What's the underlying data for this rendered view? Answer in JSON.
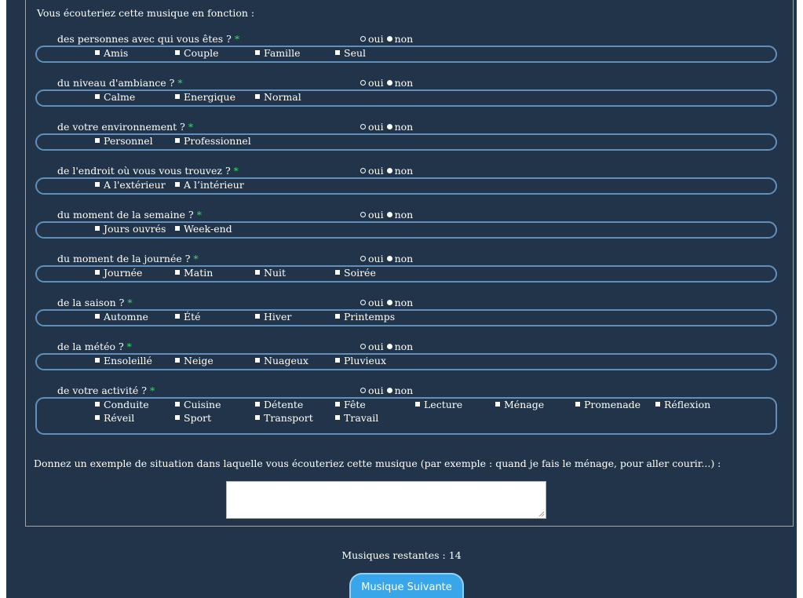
{
  "intro": "Vous écouteriez cette musique en fonction :",
  "yes_label": "oui",
  "no_label": "non",
  "required_mark": "*",
  "questions": [
    {
      "label": "des personnes avec qui vous êtes ?",
      "options": [
        "Amis",
        "Couple",
        "Famille",
        "Seul"
      ]
    },
    {
      "label": "du niveau d'ambiance ?",
      "options": [
        "Calme",
        "Energique",
        "Normal"
      ]
    },
    {
      "label": "de votre environnement ?",
      "options": [
        "Personnel",
        "Professionnel"
      ]
    },
    {
      "label": "de l'endroit où vous vous trouvez ?",
      "options": [
        "A l'extérieur",
        "A l’intérieur"
      ]
    },
    {
      "label": "du moment de la semaine ?",
      "options": [
        "Jours ouvrés",
        "Week-end"
      ]
    },
    {
      "label": "du moment de la journée ?",
      "options": [
        "Journée",
        "Matin",
        "Nuit",
        "Soirée"
      ]
    },
    {
      "label": "de la saison ?",
      "options": [
        "Automne",
        "Été",
        "Hiver",
        "Printemps"
      ]
    },
    {
      "label": "de la météo ?",
      "options": [
        "Ensoleillé",
        "Neige",
        "Nuageux",
        "Pluvieux"
      ]
    },
    {
      "label": "de votre activité ?",
      "options": [
        "Conduite",
        "Cuisine",
        "Détente",
        "Fête",
        "Lecture",
        "Ménage",
        "Promenade",
        "Réflexion",
        "Réveil",
        "Sport",
        "Transport",
        "Travail"
      ]
    }
  ],
  "example_prompt": "Donnez un exemple de situation dans laquelle vous écouteriez cette musique (par exemple : quand je fais le ménage, pour aller courir...) :",
  "example_value": "",
  "remaining_text": "Musiques restantes : 14",
  "next_button": "Musique Suivante"
}
